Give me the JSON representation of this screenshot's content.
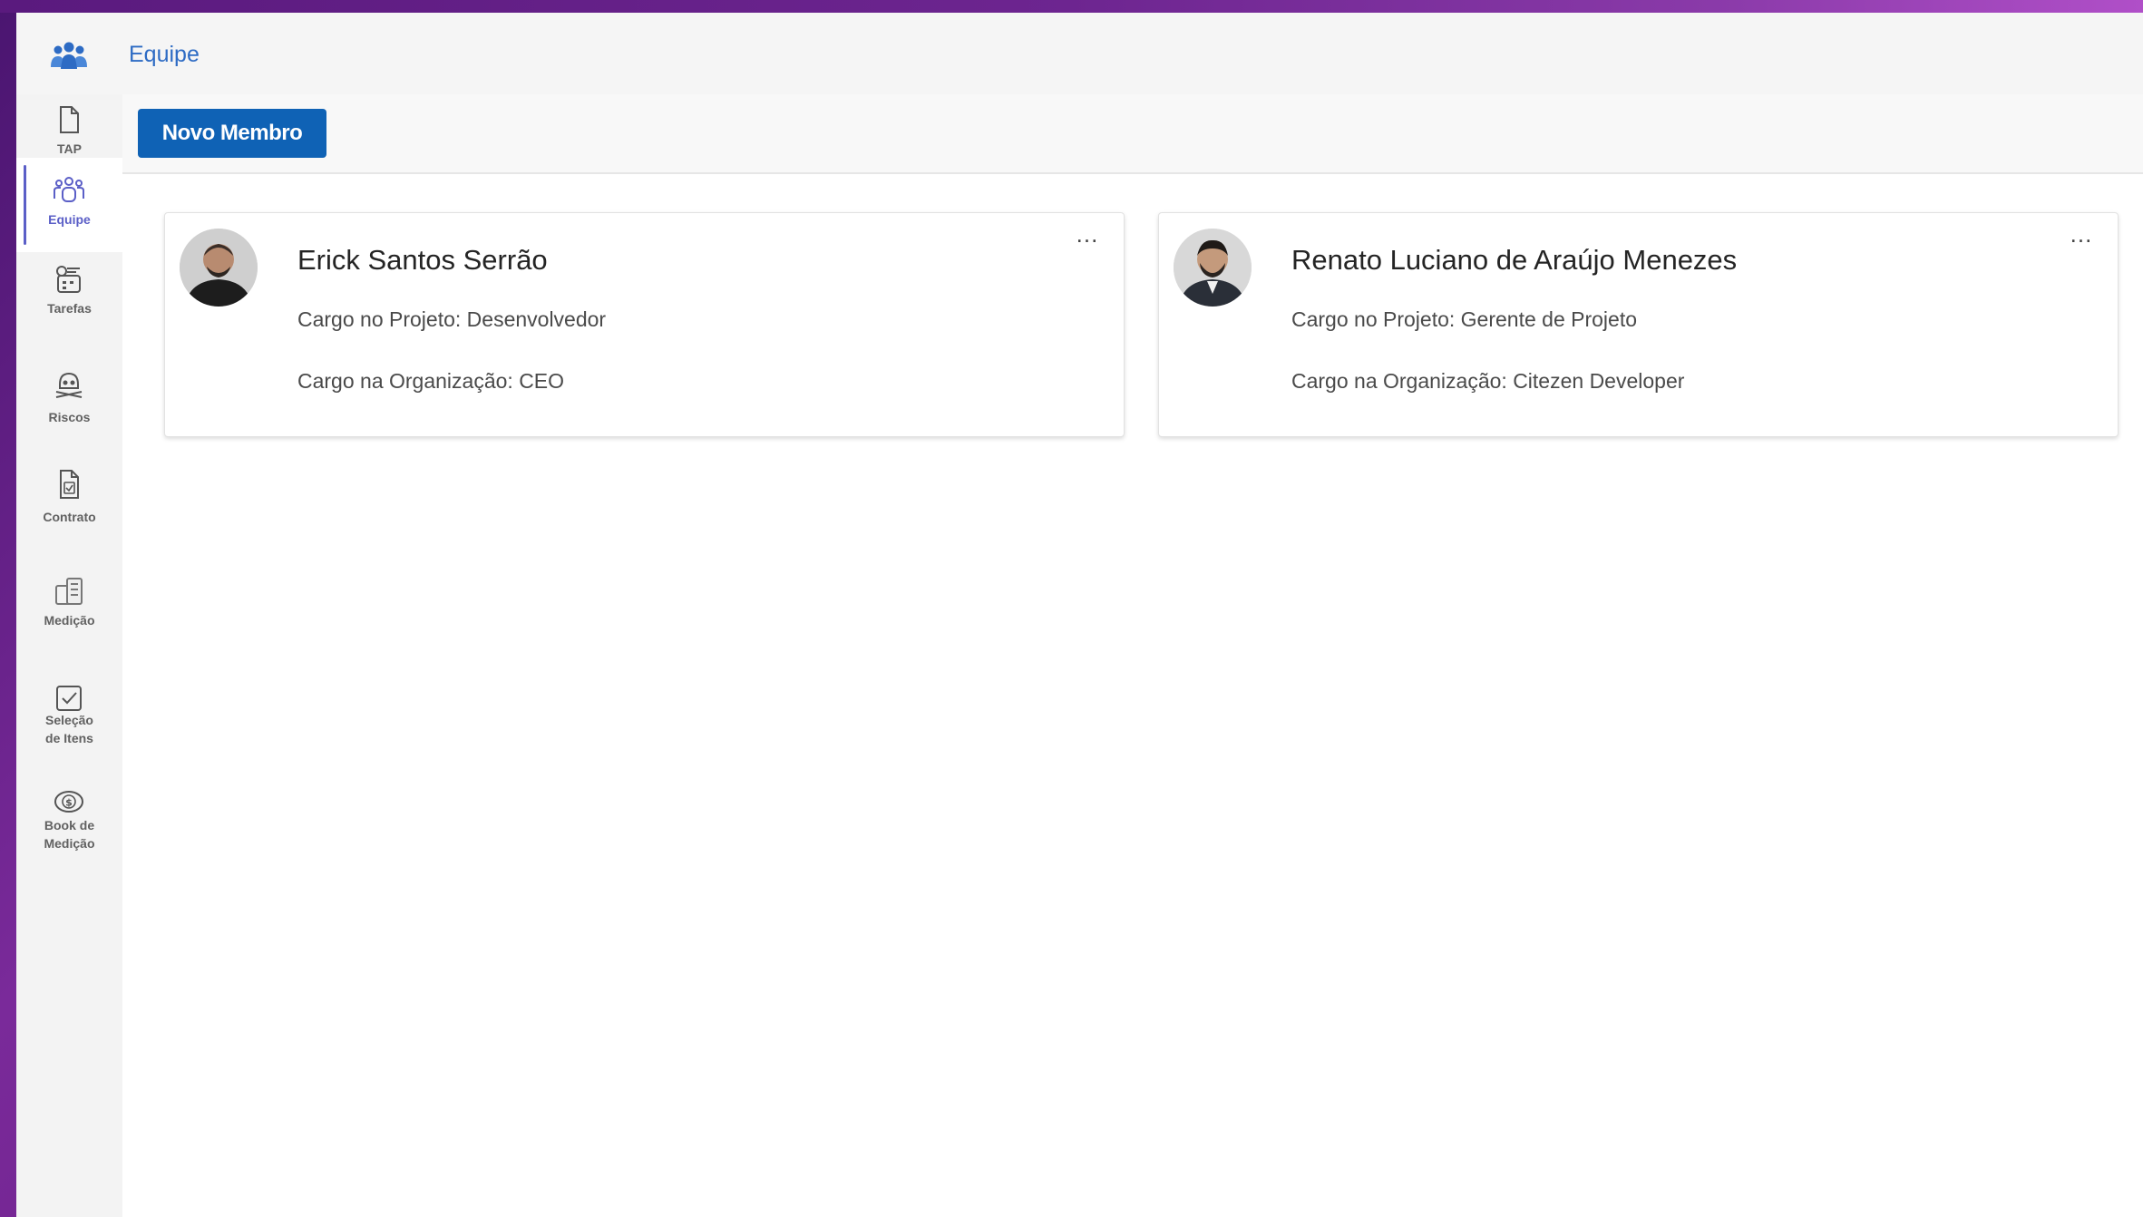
{
  "header": {
    "title": "Equipe",
    "logo_icon": "team-icon",
    "accent_color": "#2d6bc4"
  },
  "sidebar": {
    "active_color": "#5b5fc7",
    "items": [
      {
        "label": "TAP",
        "icon": "document-icon",
        "active": false
      },
      {
        "label": "Equipe",
        "icon": "team-icon",
        "active": true
      },
      {
        "label": "Tarefas",
        "icon": "tasks-icon",
        "active": false
      },
      {
        "label": "Riscos",
        "icon": "risk-icon",
        "active": false
      },
      {
        "label": "Contrato",
        "icon": "contract-icon",
        "active": false
      },
      {
        "label": "Medição",
        "icon": "measurement-icon",
        "active": false
      },
      {
        "label": "Seleção de Itens",
        "icon": "checkbox-icon",
        "active": false
      },
      {
        "label": "Book de Medição",
        "icon": "money-icon",
        "active": false
      }
    ]
  },
  "toolbar": {
    "new_member_label": "Novo Membro",
    "button_color": "#0f62b5"
  },
  "members": [
    {
      "name": "Erick Santos Serrão",
      "project_role": "Cargo no Projeto: Desenvolvedor",
      "org_role": "Cargo na Organização: CEO",
      "menu": "..."
    },
    {
      "name": "Renato Luciano de Araújo Menezes",
      "project_role": "Cargo no Projeto: Gerente de Projeto",
      "org_role": "Cargo na Organização: Citezen Developer",
      "menu": "..."
    }
  ]
}
